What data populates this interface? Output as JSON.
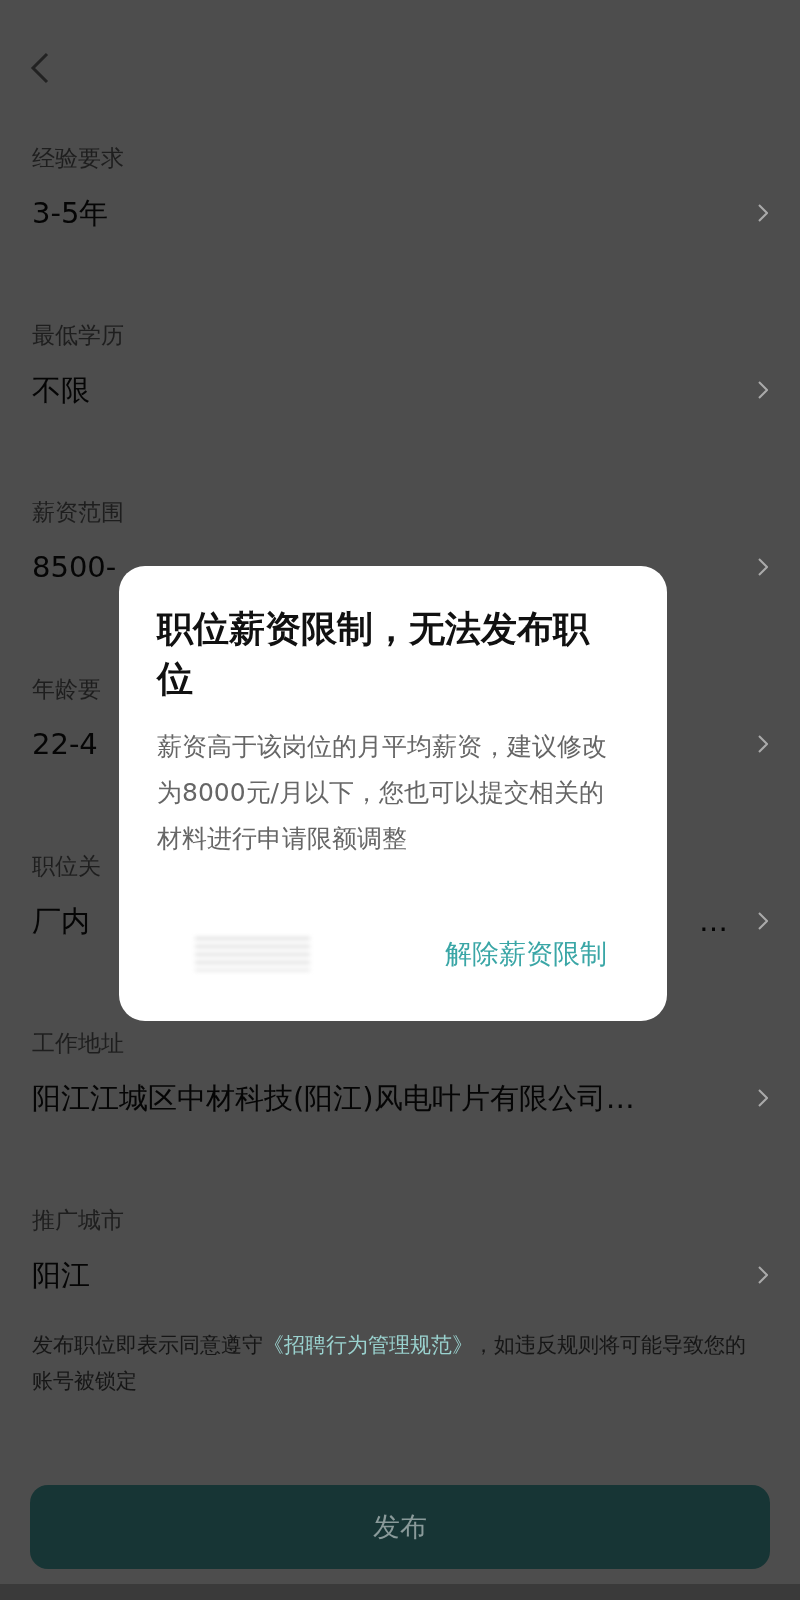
{
  "fields": [
    {
      "label": "经验要求",
      "value": "3-5年"
    },
    {
      "label": "最低学历",
      "value": "不限"
    },
    {
      "label": "薪资范围",
      "value": "8500-"
    },
    {
      "label": "年龄要",
      "value": "22-4"
    },
    {
      "label": "职位关",
      "value": "厂内",
      "trailing": "…"
    },
    {
      "label": "工作地址",
      "value": "阳江江城区中材科技(阳江)风电叶片有限公司…"
    },
    {
      "label": "推广城市",
      "value": "阳江"
    }
  ],
  "notice": {
    "before": "发布职位即表示同意遵守",
    "link": "《招聘行为管理规范》",
    "after": "，如违反规则将可能导致您的账号被锁定"
  },
  "publish_button": {
    "label": "发布"
  },
  "dialog": {
    "title": "职位薪资限制，无法发布职位",
    "message": "薪资高于该岗位的月平均薪资，建议修改为8000元/月以下，您也可以提交相关的材料进行申请限额调整",
    "action": "解除薪资限制"
  }
}
